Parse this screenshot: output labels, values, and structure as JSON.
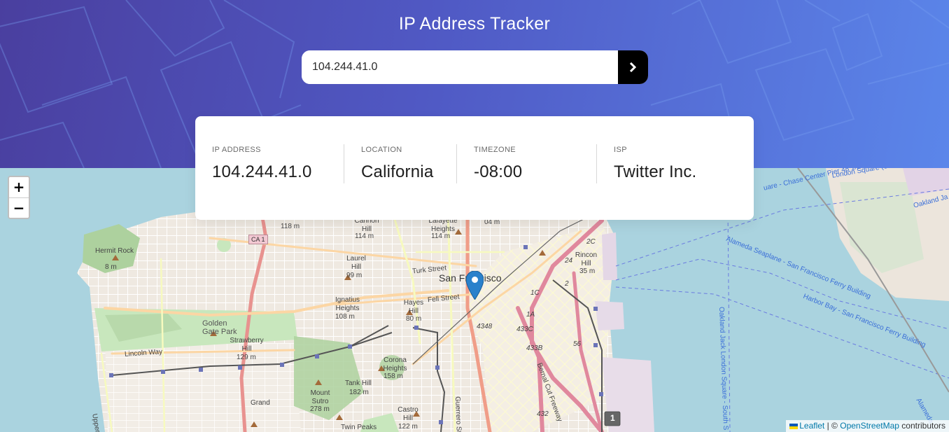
{
  "header": {
    "title": "IP Address Tracker",
    "background_gradient": [
      "#4a3f9f",
      "#5b86ea"
    ]
  },
  "search": {
    "value": "104.244.41.0",
    "button_icon": "chevron-right-icon"
  },
  "info": {
    "ip_label": "IP ADDRESS",
    "ip_value": "104.244.41.0",
    "location_label": "LOCATION",
    "location_value": "California",
    "timezone_label": "TIMEZONE",
    "timezone_value": "-08:00",
    "isp_label": "ISP",
    "isp_value": "Twitter Inc."
  },
  "map": {
    "zoom_in": "+",
    "zoom_out": "−",
    "marker_icon": "location-pin-icon",
    "attribution": {
      "leaflet": "Leaflet",
      "separator": "| ©",
      "osm": "OpenStreetMap",
      "suffix": "contributors"
    },
    "labels": {
      "san_francisco": "San Francisco",
      "golden_gate_park": "Golden Gate Park",
      "lincoln_way": "Lincoln Way",
      "hermit_rock": "Hermit Rock",
      "hermit_elev": "8 m",
      "ca1": "CA 1",
      "elev_118": "118 m",
      "cannon_hill": "Cannon Hill",
      "elev_114a": "114 m",
      "lafayette": "Lafayette Heights",
      "elev_114b": "114 m",
      "laurel": "Laurel Hill",
      "elev_99": "99 m",
      "turk": "Turk Street",
      "fell": "Fell Street",
      "ignatius": "Ignatius Heights",
      "elev_108": "108 m",
      "hayes": "Hayes Hill",
      "elev_80": "80 m",
      "strawberry": "Strawberry Hill",
      "elev_129": "129 m",
      "corona": "Corona Heights",
      "elev_158": "158 m",
      "tank": "Tank Hill",
      "elev_182": "182 m",
      "mount_sutro": "Mount Sutro",
      "elev_278": "278 m",
      "castro": "Castro Hill",
      "elev_122": "122 m",
      "twin_peaks": "Twin Peaks",
      "grand": "Grand",
      "rincon": "Rincon Hill",
      "elev_35": "35 m",
      "elev_04": "04 m",
      "upper_great": "Upper Gre",
      "guerrero": "Guerrero Str",
      "bernal": "Bernal Cut Freeway",
      "seaplane": "Alameda Seaplane - San Francisco Ferry Building",
      "harbor": "Harbor Bay - San Francisco Ferry Building",
      "oakland_jack": "Oakland Jack London Square - South S",
      "chase": "London Square (Seasonal)",
      "chase2": "uare - Chase Center Pier 48 1/2 (Seasonal)",
      "oakland": "Oakland Ja",
      "alameda": "Alameda",
      "hwy_1c": "1C",
      "hwy_4348": "4348",
      "hwy_433c": "433C",
      "hwy_433b": "433B",
      "hwy_1a": "1A",
      "hwy_432": "432",
      "hwy_56": "56",
      "hwy_2": "2",
      "hwy_2c": "2C",
      "hwy_24": "24",
      "exit_1": "1"
    }
  }
}
